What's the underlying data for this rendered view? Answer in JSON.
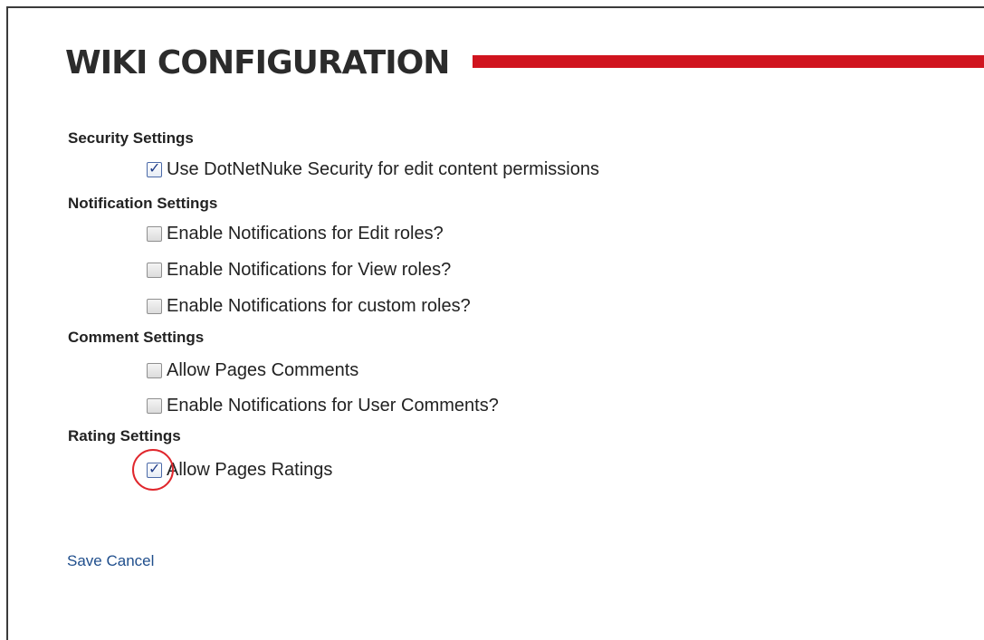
{
  "page": {
    "title": "WIKI CONFIGURATION"
  },
  "sections": {
    "security": {
      "heading": "Security Settings",
      "options": [
        {
          "label": "Use DotNetNuke Security for edit content permissions",
          "checked": true
        }
      ]
    },
    "notification": {
      "heading": "Notification Settings",
      "options": [
        {
          "label": "Enable Notifications for Edit roles?",
          "checked": false
        },
        {
          "label": "Enable Notifications for View roles?",
          "checked": false
        },
        {
          "label": "Enable Notifications for custom roles?",
          "checked": false
        }
      ]
    },
    "comment": {
      "heading": "Comment Settings",
      "options": [
        {
          "label": "Allow Pages Comments",
          "checked": false
        },
        {
          "label": "Enable Notifications for User Comments?",
          "checked": false
        }
      ]
    },
    "rating": {
      "heading": "Rating Settings",
      "options": [
        {
          "label": "Allow Pages Ratings",
          "checked": true
        }
      ]
    }
  },
  "actions": {
    "save_label": "Save",
    "cancel_label": "Cancel"
  },
  "colors": {
    "accent_rule": "#d0141e",
    "link": "#1f4e8c",
    "highlight": "#e0262c"
  }
}
